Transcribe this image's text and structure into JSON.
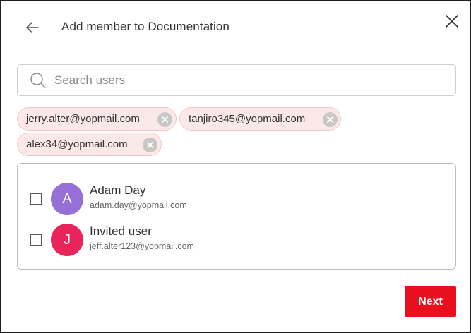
{
  "dialog": {
    "title": "Add member to Documentation",
    "back_icon": "arrow-left-icon",
    "close_icon": "close-icon"
  },
  "search": {
    "placeholder": "Search users",
    "value": "",
    "icon": "search-icon"
  },
  "selected_chips": [
    {
      "email": "jerry.alter@yopmail.com"
    },
    {
      "email": "tanjiro345@yopmail.com"
    },
    {
      "email": "alex34@yopmail.com"
    }
  ],
  "users": [
    {
      "initial": "A",
      "name": "Adam Day",
      "email": "adam.day@yopmail.com",
      "avatar_color": "#9670d6",
      "checked": false
    },
    {
      "initial": "J",
      "name": "Invited user",
      "email": "jeff.alter123@yopmail.com",
      "avatar_color": "#e8245a",
      "checked": false
    }
  ],
  "footer": {
    "next_label": "Next",
    "accent_color": "#e8101e"
  }
}
